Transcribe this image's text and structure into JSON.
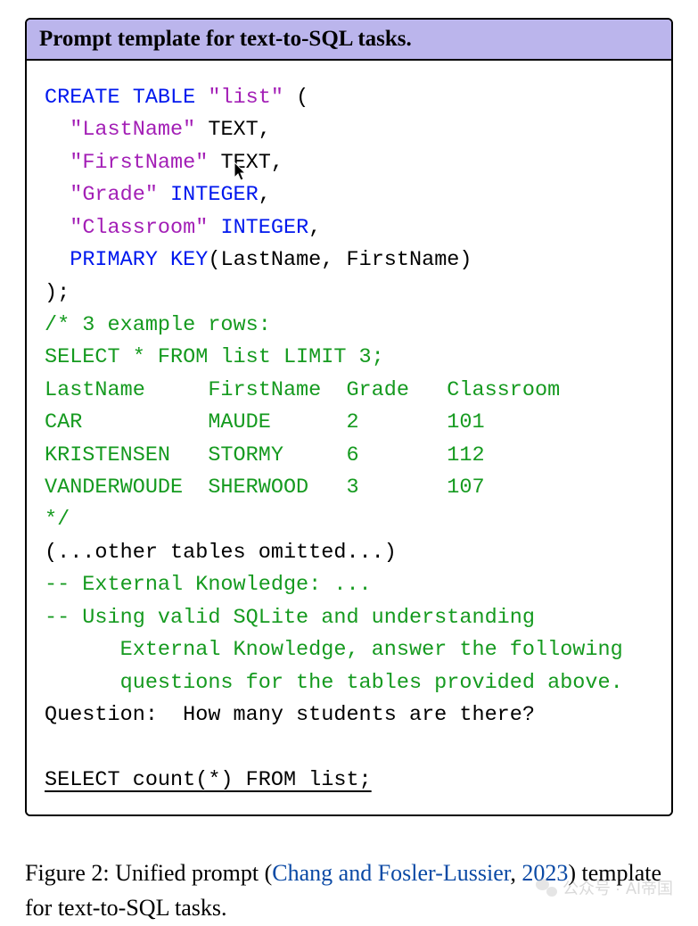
{
  "box": {
    "title": "Prompt template for text-to-SQL tasks.",
    "code": {
      "l1a": "CREATE TABLE ",
      "l1b": "\"list\"",
      "l1c": " (",
      "l2a": "  ",
      "l2b": "\"LastName\"",
      "l2c": " TEXT,",
      "l3a": "  ",
      "l3b": "\"FirstName\"",
      "l3c": " TEXT,",
      "l4a": "  ",
      "l4b": "\"Grade\"",
      "l4c": " ",
      "l4d": "INTEGER",
      "l4e": ",",
      "l5a": "  ",
      "l5b": "\"Classroom\"",
      "l5c": " ",
      "l5d": "INTEGER",
      "l5e": ",",
      "l6a": "  ",
      "l6b": "PRIMARY KEY",
      "l6c": "(LastName, FirstName)",
      "l7": ");",
      "l8": "/* 3 example rows:",
      "l9": "SELECT * FROM list LIMIT 3;",
      "l10": "LastName     FirstName  Grade   Classroom",
      "l11": "CAR          MAUDE      2       101",
      "l12": "KRISTENSEN   STORMY     6       112",
      "l13": "VANDERWOUDE  SHERWOOD   3       107",
      "l14": "*/",
      "l15": "(...other tables omitted...)",
      "l16": "-- External Knowledge: ...",
      "l17": "-- Using valid SQLite and understanding",
      "l18": "      External Knowledge, answer the following",
      "l19": "      questions for the tables provided above.",
      "l20": "Question:  How many students are there?",
      "l21": "",
      "l22": "SELECT count(*) FROM list;"
    }
  },
  "caption": {
    "prefix": "Figure 2:  Unified prompt (",
    "cite1": "Chang and Fosler-Lussier",
    "sep": ",",
    "cite2": "2023",
    "suffix": ") template for text-to-SQL tasks."
  },
  "watermark": {
    "label": "公众号 · ",
    "brand": "AI帝国"
  }
}
